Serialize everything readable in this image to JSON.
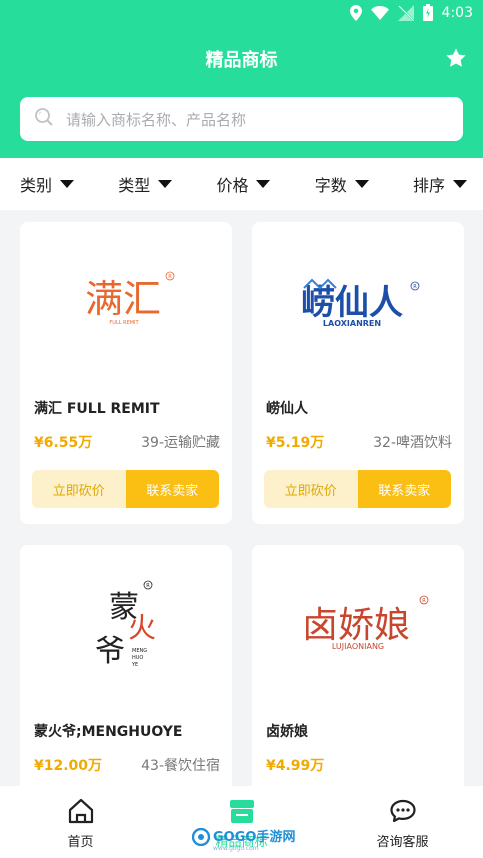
{
  "status": {
    "time": "4:03"
  },
  "header": {
    "title": "精品商标"
  },
  "search": {
    "placeholder": "请输入商标名称、产品名称"
  },
  "filters": [
    "类别",
    "类型",
    "价格",
    "字数",
    "排序"
  ],
  "cards": [
    {
      "logo_cn": "满汇",
      "logo_sub": "FULL REMIT",
      "name": "满汇 FULL REMIT",
      "price": "¥6.55万",
      "category": "39-运输贮藏",
      "bargain": "立即砍价",
      "contact": "联系卖家"
    },
    {
      "logo_cn": "崂仙人",
      "logo_sub": "LAOXIANREN",
      "name": "崂仙人",
      "price": "¥5.19万",
      "category": "32-啤酒饮料",
      "bargain": "立即砍价",
      "contact": "联系卖家"
    },
    {
      "logo_cn": "蒙火爷",
      "logo_sub": "MENG HUO YE",
      "name": "蒙火爷;MENGHUOYE",
      "price": "¥12.00万",
      "category": "43-餐饮住宿"
    },
    {
      "logo_cn": "卤娇娘",
      "logo_sub": "LUJIAONIANG",
      "name": "卤娇娘",
      "price": "¥4.99万"
    }
  ],
  "tabs": [
    "首页",
    "精品商标",
    "咨询客服"
  ],
  "watermark": {
    "brand": "GOGO手游网",
    "domain": "www.gogo.com"
  }
}
